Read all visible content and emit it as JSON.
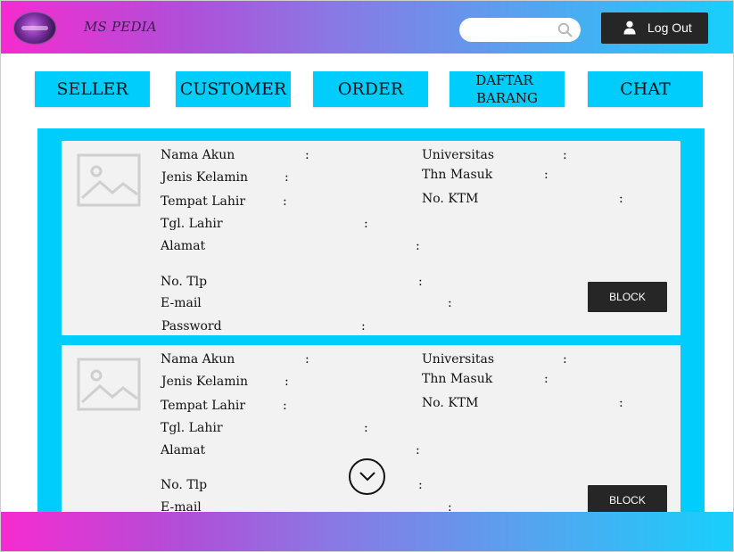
{
  "header": {
    "brand": "MS PEDIA",
    "search": {
      "placeholder": "",
      "icon": "search-icon"
    },
    "logout_label": "Log Out",
    "gradient": [
      "#f62bd0",
      "#17d0fb"
    ]
  },
  "nav": {
    "seller": "SELLER",
    "customer": "CUSTOMER",
    "order": "ORDER",
    "daftar_line1": "DAFTAR",
    "daftar_line2": "BARANG",
    "chat": "CHAT"
  },
  "fields": {
    "nama_akun": "Nama Akun",
    "jenis_kelamin": "Jenis Kelamin",
    "tempat_lahir": "Tempat Lahir",
    "tgl_lahir": "Tgl. Lahir",
    "alamat": "Alamat",
    "no_tlp": "No. Tlp",
    "email": "E-mail",
    "password": "Password",
    "universitas": "Universitas",
    "thn_masuk": "Thn Masuk",
    "no_ktm": "No. KTM",
    "colon": ":"
  },
  "cards": [
    {
      "block_label": "BLOCK"
    },
    {
      "block_label": "BLOCK"
    }
  ],
  "colors": {
    "accent": "#00cdfb",
    "card_bg": "#f2f2f2",
    "dark_button": "#262626"
  }
}
